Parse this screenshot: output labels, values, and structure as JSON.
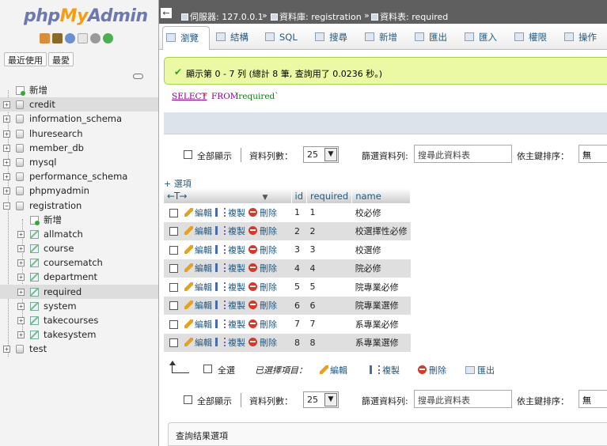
{
  "nav": {
    "logo": {
      "php": "php",
      "my": "My",
      "admin": "Admin"
    },
    "buttons": {
      "recent": "最近使用",
      "favorites": "最愛"
    },
    "tree": [
      {
        "label": "新增",
        "kind": "new",
        "level": 0
      },
      {
        "label": "credit",
        "kind": "db",
        "level": 0,
        "selected": true
      },
      {
        "label": "information_schema",
        "kind": "db",
        "level": 0
      },
      {
        "label": "lhuresearch",
        "kind": "db",
        "level": 0
      },
      {
        "label": "member_db",
        "kind": "db",
        "level": 0
      },
      {
        "label": "mysql",
        "kind": "db",
        "level": 0
      },
      {
        "label": "performance_schema",
        "kind": "db",
        "level": 0
      },
      {
        "label": "phpmyadmin",
        "kind": "db",
        "level": 0
      },
      {
        "label": "registration",
        "kind": "db",
        "level": 0,
        "expanded": true
      },
      {
        "label": "新增",
        "kind": "new",
        "level": 1
      },
      {
        "label": "allmatch",
        "kind": "table",
        "level": 1
      },
      {
        "label": "course",
        "kind": "table",
        "level": 1
      },
      {
        "label": "coursematch",
        "kind": "table",
        "level": 1
      },
      {
        "label": "department",
        "kind": "table",
        "level": 1
      },
      {
        "label": "required",
        "kind": "table",
        "level": 1,
        "selected": true
      },
      {
        "label": "system",
        "kind": "table",
        "level": 1
      },
      {
        "label": "takecourses",
        "kind": "table",
        "level": 1
      },
      {
        "label": "takesystem",
        "kind": "table",
        "level": 1
      },
      {
        "label": "test",
        "kind": "db",
        "level": 0
      }
    ]
  },
  "breadcrumb": {
    "server": "伺服器: 127.0.0.1",
    "db": "資料庫: registration",
    "table": "資料表: required",
    "sep": "»"
  },
  "tabs": [
    {
      "label": "瀏覽",
      "icon": "browse-icon",
      "active": true
    },
    {
      "label": "結構",
      "icon": "structure-icon"
    },
    {
      "label": "SQL",
      "icon": "sql-icon"
    },
    {
      "label": "搜尋",
      "icon": "search-icon"
    },
    {
      "label": "新增",
      "icon": "insert-icon"
    },
    {
      "label": "匯出",
      "icon": "export-icon"
    },
    {
      "label": "匯入",
      "icon": "import-icon"
    },
    {
      "label": "權限",
      "icon": "privileges-icon"
    },
    {
      "label": "操作",
      "icon": "operations-icon"
    }
  ],
  "notice": "顯示第 0 - 7 列 (總計 8 筆, 查詢用了 0.0236 秒。)",
  "sql": {
    "select": "SELECT",
    "star": "*",
    "from": "FROM",
    "table": "`required`"
  },
  "controls": {
    "show_all": "全部顯示",
    "rows_label": "資料列數：",
    "rows_value": "25",
    "filter_label": "篩選資料列:",
    "filter_placeholder": "搜尋此資料表",
    "sort_label": "依主鍵排序：",
    "sort_value": "無"
  },
  "options_link": "+ 選項",
  "table": {
    "columns": [
      "id",
      "required",
      "name"
    ],
    "actions": {
      "edit": "編輯",
      "copy": "複製",
      "delete": "刪除"
    },
    "rows": [
      {
        "id": "1",
        "required": "1",
        "name": "校必修"
      },
      {
        "id": "2",
        "required": "2",
        "name": "校選擇性必修"
      },
      {
        "id": "3",
        "required": "3",
        "name": "校選修"
      },
      {
        "id": "4",
        "required": "4",
        "name": "院必修"
      },
      {
        "id": "5",
        "required": "5",
        "name": "院專業必修"
      },
      {
        "id": "6",
        "required": "6",
        "name": "院專業選修"
      },
      {
        "id": "7",
        "required": "7",
        "name": "系專業必修"
      },
      {
        "id": "8",
        "required": "8",
        "name": "系專業選修"
      }
    ]
  },
  "bulk": {
    "select_all": "全選",
    "selected": "已選擇項目：",
    "edit": "編輯",
    "copy": "複製",
    "delete": "刪除",
    "export": "匯出"
  },
  "query_options": "查詢结果選項",
  "colors": {
    "link": "#235a81",
    "topbar": "#5f5f5f",
    "notice_bg": "#ebf8a4",
    "row_alt": "#dfdfdf"
  }
}
